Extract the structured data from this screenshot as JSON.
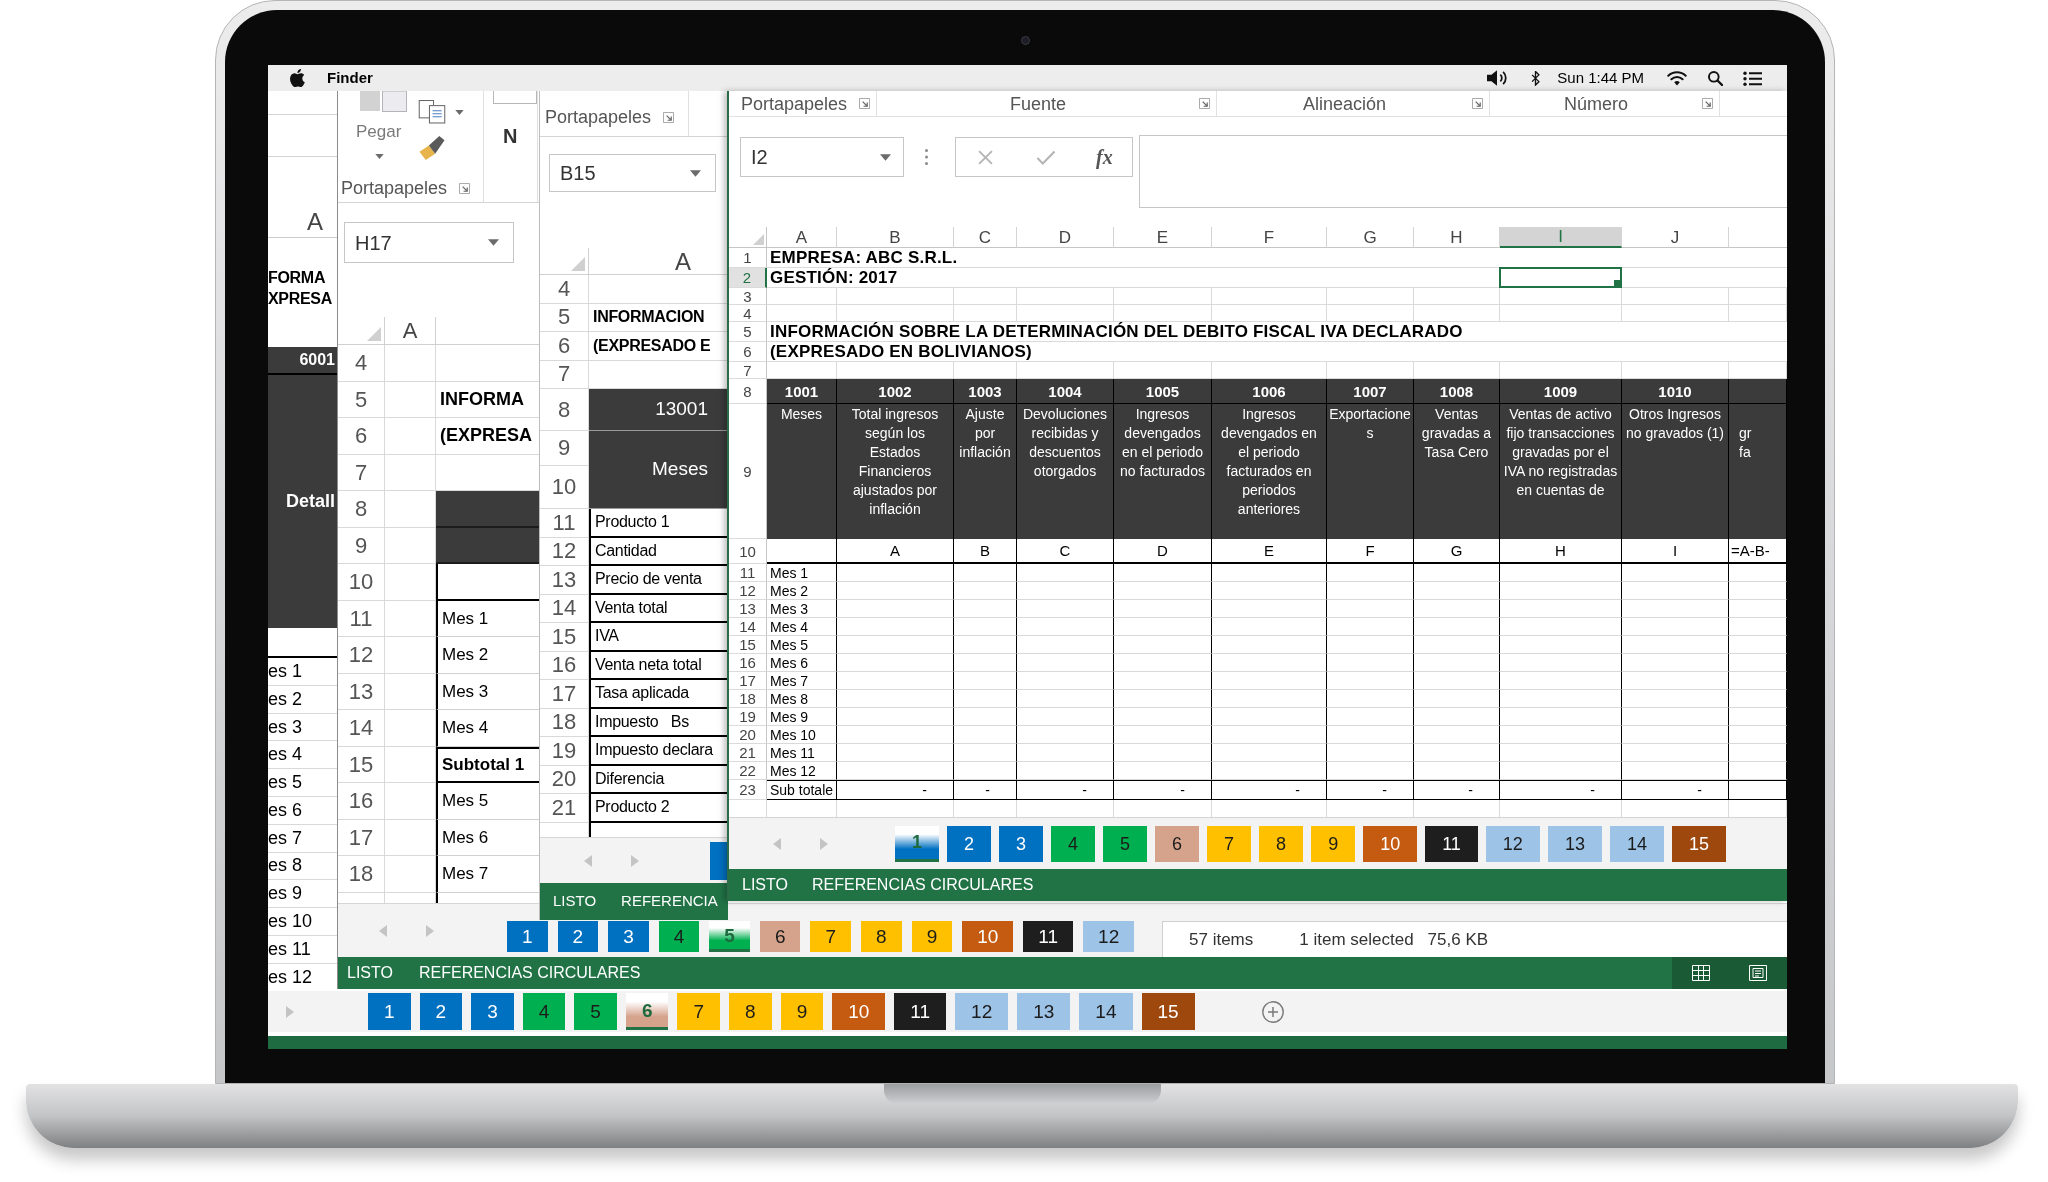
{
  "menu_bar": {
    "app_name": "Finder",
    "clock": "Sun 1:44 PM"
  },
  "window_a": {
    "column_header": "A",
    "title_lines": [
      "FORMA",
      "XPRESA"
    ],
    "header_code": "6001",
    "header_label": "Detall",
    "rows": [
      "es 1",
      "es 2",
      "es 3",
      "es 4",
      "es 5",
      "es 6",
      "es 7",
      "es 8",
      "es 9",
      "es 10",
      "es 11",
      "es 12"
    ],
    "sheet_tabs": [
      {
        "label": "1",
        "color": "#0070c0",
        "selected": false
      },
      {
        "label": "2",
        "color": "#0070c0",
        "selected": false
      },
      {
        "label": "3",
        "color": "#0070c0",
        "selected": false
      },
      {
        "label": "4",
        "color": "#00b050",
        "selected": false
      },
      {
        "label": "5",
        "color": "#00b050",
        "selected": false
      },
      {
        "label": "6",
        "color": "#d5a28c",
        "selected": true
      },
      {
        "label": "7",
        "color": "#ffc000",
        "selected": false
      },
      {
        "label": "8",
        "color": "#ffc000",
        "selected": false
      },
      {
        "label": "9",
        "color": "#ffc000",
        "selected": false
      },
      {
        "label": "10",
        "color": "#c55a11",
        "selected": false
      },
      {
        "label": "11",
        "color": "#1e1e1e",
        "selected": false
      },
      {
        "label": "12",
        "color": "#9dc3e6",
        "selected": false
      },
      {
        "label": "13",
        "color": "#9dc3e6",
        "selected": false
      },
      {
        "label": "14",
        "color": "#9dc3e6",
        "selected": false
      },
      {
        "label": "15",
        "color": "#9e480e",
        "selected": false
      }
    ]
  },
  "window_b": {
    "ribbon": {
      "paste_label": "Pegar",
      "bold_button": "N",
      "group_label": "Portapapeles"
    },
    "name_box": "H17",
    "column_header": "A",
    "rows": [
      {
        "number": "4",
        "kind": "blank"
      },
      {
        "number": "5",
        "kind": "title",
        "text": "INFORMA"
      },
      {
        "number": "6",
        "kind": "title",
        "text": "(EXPRESA"
      },
      {
        "number": "7",
        "kind": "blank"
      },
      {
        "number": "8",
        "kind": "header"
      },
      {
        "number": "9",
        "kind": "header"
      },
      {
        "number": "10",
        "kind": "spacer"
      },
      {
        "number": "11",
        "kind": "item",
        "text": "Mes 1"
      },
      {
        "number": "12",
        "kind": "item",
        "text": "Mes 2"
      },
      {
        "number": "13",
        "kind": "item",
        "text": "Mes 3"
      },
      {
        "number": "14",
        "kind": "item",
        "text": "Mes 4"
      },
      {
        "number": "15",
        "kind": "subtotal",
        "text": "Subtotal 1"
      },
      {
        "number": "16",
        "kind": "item",
        "text": "Mes 5"
      },
      {
        "number": "17",
        "kind": "item",
        "text": "Mes 6"
      },
      {
        "number": "18",
        "kind": "item",
        "text": "Mes 7"
      }
    ],
    "sheet_tabs": [
      {
        "label": "1",
        "color": "#0070c0",
        "selected": false
      },
      {
        "label": "2",
        "color": "#0070c0",
        "selected": false
      },
      {
        "label": "3",
        "color": "#0070c0",
        "selected": false
      },
      {
        "label": "4",
        "color": "#00b050",
        "selected": false
      },
      {
        "label": "5",
        "color": "#00b050",
        "selected": true
      },
      {
        "label": "6",
        "color": "#d5a28c",
        "selected": false
      },
      {
        "label": "7",
        "color": "#ffc000",
        "selected": false
      },
      {
        "label": "8",
        "color": "#ffc000",
        "selected": false
      },
      {
        "label": "9",
        "color": "#ffc000",
        "selected": false
      },
      {
        "label": "10",
        "color": "#c55a11",
        "selected": false
      },
      {
        "label": "11",
        "color": "#1e1e1e",
        "selected": false
      },
      {
        "label": "12",
        "color": "#9dc3e6",
        "selected": false
      }
    ],
    "status_bar": {
      "ready": "LISTO",
      "mode": "REFERENCIAS CIRCULARES"
    }
  },
  "window_c": {
    "ribbon": {
      "group_label": "Portapapeles"
    },
    "name_box": "B15",
    "column_header": "A",
    "rows": [
      {
        "numbers": [
          "4"
        ],
        "kind": "blank"
      },
      {
        "numbers": [
          "5"
        ],
        "kind": "title",
        "text": "INFORMACION"
      },
      {
        "numbers": [
          "6"
        ],
        "kind": "title",
        "text": "(EXPRESADO E"
      },
      {
        "numbers": [
          "7"
        ],
        "kind": "blank"
      },
      {
        "numbers": [
          "8"
        ],
        "kind": "header",
        "text": "13001"
      },
      {
        "numbers": [
          "9",
          "10"
        ],
        "kind": "header",
        "text": "Meses"
      },
      {
        "numbers": [
          "11"
        ],
        "kind": "item",
        "text": "Producto 1"
      },
      {
        "numbers": [
          "12"
        ],
        "kind": "item",
        "text": "Cantidad"
      },
      {
        "numbers": [
          "13"
        ],
        "kind": "item",
        "text": "Precio de venta"
      },
      {
        "numbers": [
          "14"
        ],
        "kind": "item",
        "text": "Venta total"
      },
      {
        "numbers": [
          "15"
        ],
        "kind": "item",
        "text": "IVA"
      },
      {
        "numbers": [
          "16"
        ],
        "kind": "item",
        "text": "Venta neta total"
      },
      {
        "numbers": [
          "17"
        ],
        "kind": "item",
        "text": "Tasa aplicada"
      },
      {
        "numbers": [
          "18"
        ],
        "kind": "item",
        "text": "Impuesto   Bs"
      },
      {
        "numbers": [
          "19"
        ],
        "kind": "item",
        "text": "Impuesto declara"
      },
      {
        "numbers": [
          "20"
        ],
        "kind": "item",
        "text": "Diferencia"
      },
      {
        "numbers": [
          "21"
        ],
        "kind": "item",
        "text": "Producto 2"
      }
    ],
    "sheet_tabs": [
      {
        "color": "#0070c0",
        "selected": false
      }
    ],
    "status_bar": {
      "ready": "LISTO",
      "mode": "REFERENCIA"
    }
  },
  "finder_status": {
    "item_count": "57 items",
    "selection": "1 item selected",
    "size": "75,6 KB"
  },
  "window_d": {
    "ribbon_groups": [
      "Portapapeles",
      "Fuente",
      "Alineación",
      "Número"
    ],
    "name_box": "I2",
    "formula_symbol": "fx",
    "columns": [
      {
        "label": "A",
        "selected": false
      },
      {
        "label": "B",
        "selected": false
      },
      {
        "label": "C",
        "selected": false
      },
      {
        "label": "D",
        "selected": false
      },
      {
        "label": "E",
        "selected": false
      },
      {
        "label": "F",
        "selected": false
      },
      {
        "label": "G",
        "selected": false
      },
      {
        "label": "H",
        "selected": false
      },
      {
        "label": "I",
        "selected": true
      },
      {
        "label": "J",
        "selected": false
      }
    ],
    "rows": [
      {
        "number": "1",
        "selected": false,
        "kind": "title",
        "text": "EMPRESA: ABC S.R.L."
      },
      {
        "number": "2",
        "selected": true,
        "kind": "title",
        "text": "GESTIÓN: 2017"
      },
      {
        "number": "3",
        "selected": false,
        "kind": "blank"
      },
      {
        "number": "4",
        "selected": false,
        "kind": "blank"
      },
      {
        "number": "5",
        "selected": false,
        "kind": "title",
        "text": "INFORMACIÓN SOBRE LA DETERMINACIÓN DEL DEBITO FISCAL IVA DECLARADO"
      },
      {
        "number": "6",
        "selected": false,
        "kind": "title",
        "text": "(EXPRESADO EN BOLIVIANOS)"
      },
      {
        "number": "7",
        "selected": false,
        "kind": "blank"
      },
      {
        "number": "8",
        "selected": false,
        "kind": "codes",
        "cells": [
          "1001",
          "1002",
          "1003",
          "1004",
          "1005",
          "1006",
          "1007",
          "1008",
          "1009",
          "1010"
        ]
      },
      {
        "number": "9",
        "selected": false,
        "kind": "headings",
        "cells": [
          "Meses",
          "Total ingresos según los Estados Financieros ajustados por inflación",
          "Ajuste por inflación",
          "Devoluciones recibidas y descuentos otorgados",
          "Ingresos devengados en el periodo no facturados",
          "Ingresos devengados en el periodo facturados en periodos anteriores",
          "Exportaciones",
          "Ventas gravadas a Tasa Cero",
          "Ventas de activo fijo transacciones gravadas por el IVA no registradas en cuentas de",
          "Otros Ingresos no gravados (1)",
          "gr fa"
        ]
      },
      {
        "number": "10",
        "selected": false,
        "kind": "letters",
        "cells": [
          "A",
          "B",
          "C",
          "D",
          "E",
          "F",
          "G",
          "H",
          "I",
          "=A-B-"
        ]
      },
      {
        "number": "11",
        "selected": false,
        "kind": "item",
        "text": "Mes 1"
      },
      {
        "number": "12",
        "selected": false,
        "kind": "item",
        "text": "Mes 2"
      },
      {
        "number": "13",
        "selected": false,
        "kind": "item",
        "text": "Mes 3"
      },
      {
        "number": "14",
        "selected": false,
        "kind": "item",
        "text": "Mes 4"
      },
      {
        "number": "15",
        "selected": false,
        "kind": "item",
        "text": "Mes 5"
      },
      {
        "number": "16",
        "selected": false,
        "kind": "item",
        "text": "Mes 6"
      },
      {
        "number": "17",
        "selected": false,
        "kind": "item",
        "text": "Mes 7"
      },
      {
        "number": "18",
        "selected": false,
        "kind": "item",
        "text": "Mes 8"
      },
      {
        "number": "19",
        "selected": false,
        "kind": "item",
        "text": "Mes 9"
      },
      {
        "number": "20",
        "selected": false,
        "kind": "item",
        "text": "Mes 10"
      },
      {
        "number": "21",
        "selected": false,
        "kind": "item",
        "text": "Mes 11"
      },
      {
        "number": "22",
        "selected": false,
        "kind": "item",
        "text": "Mes 12"
      },
      {
        "number": "23",
        "selected": false,
        "kind": "subtotal",
        "text": "Sub totale",
        "cells": [
          "-",
          "-",
          "-",
          "-",
          "-",
          "-",
          "-",
          "-",
          "-"
        ]
      }
    ],
    "sheet_tabs": [
      {
        "label": "1",
        "color": "#0070c0",
        "selected": true
      },
      {
        "label": "2",
        "color": "#0070c0",
        "selected": false
      },
      {
        "label": "3",
        "color": "#0070c0",
        "selected": false
      },
      {
        "label": "4",
        "color": "#00b050",
        "selected": false
      },
      {
        "label": "5",
        "color": "#00b050",
        "selected": false
      },
      {
        "label": "6",
        "color": "#d5a28c",
        "selected": false
      },
      {
        "label": "7",
        "color": "#ffc000",
        "selected": false
      },
      {
        "label": "8",
        "color": "#ffc000",
        "selected": false
      },
      {
        "label": "9",
        "color": "#ffc000",
        "selected": false
      },
      {
        "label": "10",
        "color": "#c55a11",
        "selected": false
      },
      {
        "label": "11",
        "color": "#1e1e1e",
        "selected": false
      },
      {
        "label": "12",
        "color": "#9dc3e6",
        "selected": false
      },
      {
        "label": "13",
        "color": "#9dc3e6",
        "selected": false
      },
      {
        "label": "14",
        "color": "#9dc3e6",
        "selected": false
      },
      {
        "label": "15",
        "color": "#9e480e",
        "selected": false
      }
    ],
    "status_bar": {
      "ready": "LISTO",
      "mode": "REFERENCIAS CIRCULARES"
    }
  }
}
